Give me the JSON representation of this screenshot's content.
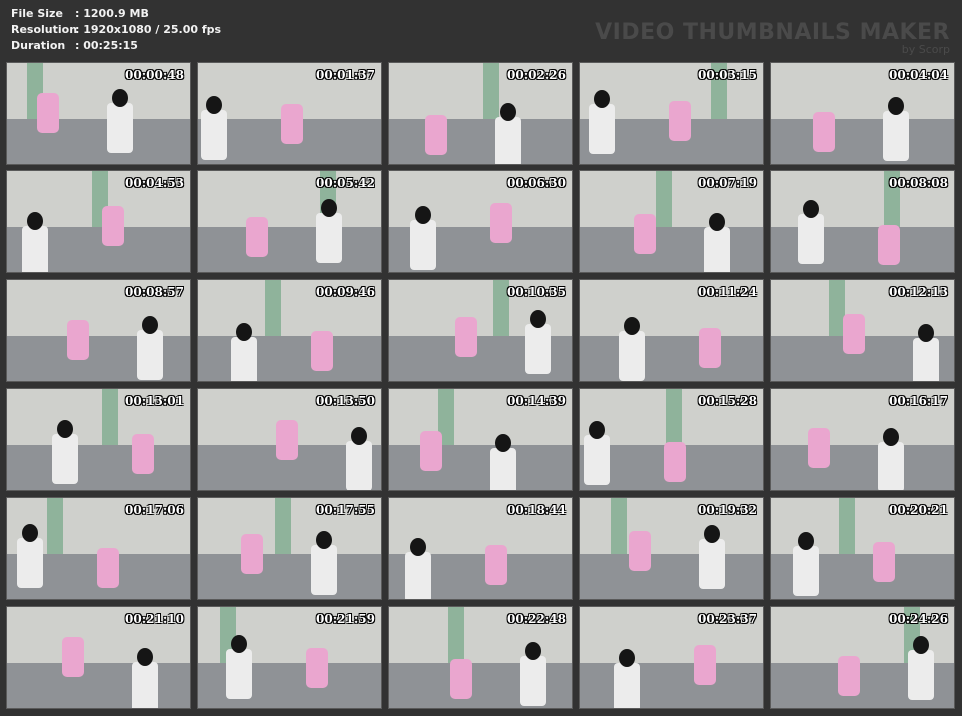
{
  "info": {
    "file_size_label": "File Size",
    "file_size_value": ": 1200.9 MB",
    "resolution_label": "Resolution",
    "resolution_value": ": 1920x1080 / 25.00 fps",
    "duration_label": "Duration",
    "duration_value": ": 00:25:15"
  },
  "brand": {
    "title": "VIDEO THUMBNAILS MAKER",
    "subtitle": "by Scorp"
  },
  "thumbnails": [
    "00:00:48",
    "00:01:37",
    "00:02:26",
    "00:03:15",
    "00:04:04",
    "00:04:53",
    "00:05:42",
    "00:06:30",
    "00:07:19",
    "00:08:08",
    "00:08:57",
    "00:09:46",
    "00:10:35",
    "00:11:24",
    "00:12:13",
    "00:13:01",
    "00:13:50",
    "00:14:39",
    "00:15:28",
    "00:16:17",
    "00:17:06",
    "00:17:55",
    "00:18:44",
    "00:19:32",
    "00:20:21",
    "00:21:10",
    "00:21:59",
    "00:22:48",
    "00:23:37",
    "00:24:26"
  ]
}
